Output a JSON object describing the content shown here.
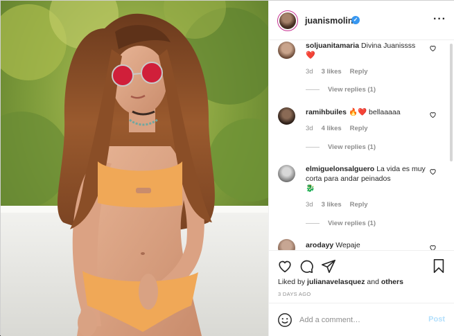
{
  "post": {
    "username": "juanismolina",
    "verified_icon": "verified-badge-icon",
    "more_icon": "more-options-icon"
  },
  "comments": [
    {
      "username": "soljuanitamaria",
      "text": "Divina Juanissss",
      "emoji": "❤️",
      "time": "3d",
      "likes": "3 likes",
      "reply": "Reply",
      "view_replies": "View replies (1)"
    },
    {
      "username": "ramihbuiles",
      "text": "bellaaaaa",
      "emoji": "🔥❤️",
      "time": "3d",
      "likes": "4 likes",
      "reply": "Reply",
      "view_replies": "View replies (1)"
    },
    {
      "username": "elmiguelonsalguero",
      "text": "La vida es muy corta para andar peinados",
      "emoji": "🐉",
      "time": "3d",
      "likes": "3 likes",
      "reply": "Reply",
      "view_replies": "View replies (1)"
    },
    {
      "username": "arodayy",
      "text": "Wepaje"
    }
  ],
  "actions": {
    "liked_prefix": "Liked by",
    "liked_user": "julianavelasquez",
    "liked_and": "and",
    "liked_others": "others",
    "posted": "3 DAYS AGO"
  },
  "add_comment": {
    "placeholder": "Add a comment…",
    "post_label": "Post"
  },
  "colors": {
    "accent": "#3897f0",
    "post_disabled": "#b2dffc",
    "heart": "#ed4956"
  }
}
